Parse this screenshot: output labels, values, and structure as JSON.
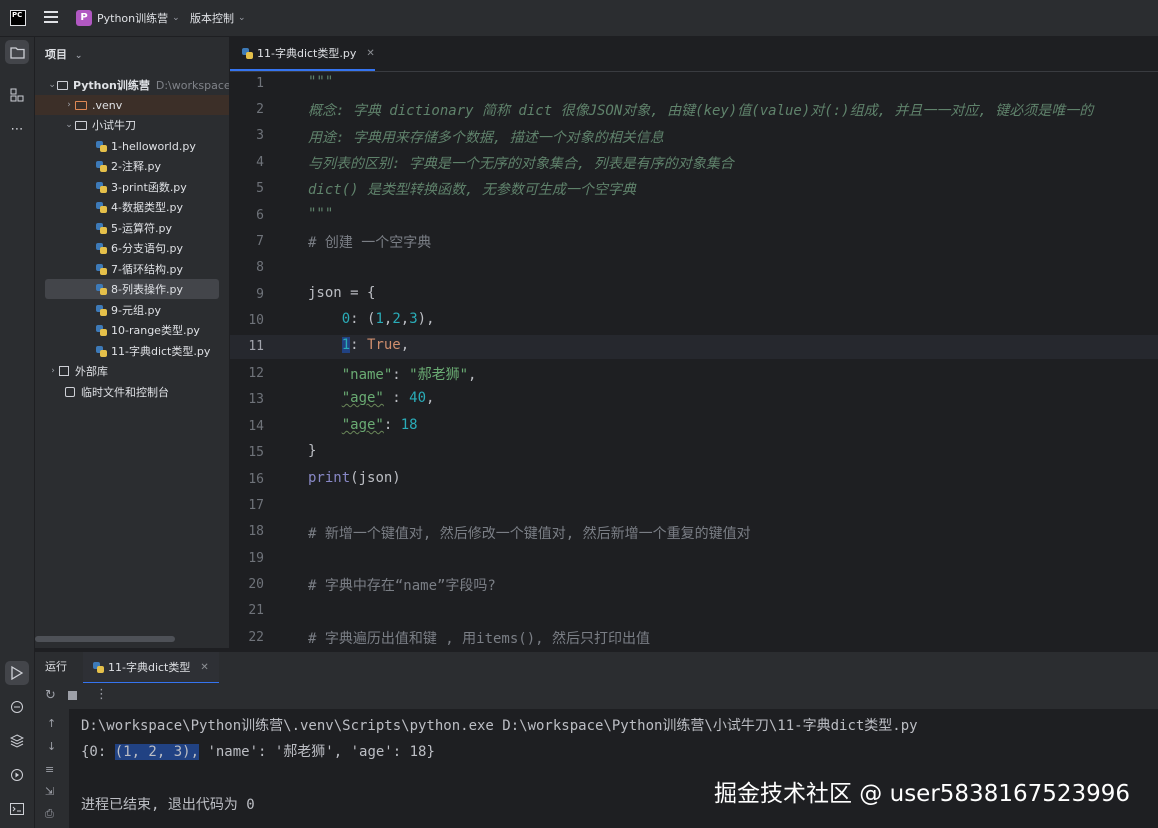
{
  "titlebar": {
    "app_logo": "PC",
    "project_name": "Python训练营",
    "project_badge": "P",
    "vcs_label": "版本控制"
  },
  "project_panel": {
    "header": "项目",
    "tree": [
      {
        "label": "Python训练营",
        "path": "D:\\workspace\\P",
        "type": "root",
        "expanded": true
      },
      {
        "label": ".venv",
        "type": "venv-folder",
        "expanded": false
      },
      {
        "label": "小试牛刀",
        "type": "folder",
        "expanded": true
      },
      {
        "label": "1-helloworld.py",
        "type": "py"
      },
      {
        "label": "2-注释.py",
        "type": "py"
      },
      {
        "label": "3-print函数.py",
        "type": "py"
      },
      {
        "label": "4-数据类型.py",
        "type": "py"
      },
      {
        "label": "5-运算符.py",
        "type": "py"
      },
      {
        "label": "6-分支语句.py",
        "type": "py"
      },
      {
        "label": "7-循环结构.py",
        "type": "py"
      },
      {
        "label": "8-列表操作.py",
        "type": "py",
        "selected": true
      },
      {
        "label": "9-元组.py",
        "type": "py"
      },
      {
        "label": "10-range类型.py",
        "type": "py"
      },
      {
        "label": "11-字典dict类型.py",
        "type": "py"
      },
      {
        "label": "外部库",
        "type": "library",
        "expanded": false
      },
      {
        "label": "临时文件和控制台",
        "type": "scratch"
      }
    ]
  },
  "editor": {
    "tab_label": "11-字典dict类型.py",
    "current_line": 11,
    "line_numbers": [
      "1",
      "2",
      "3",
      "4",
      "5",
      "6",
      "7",
      "8",
      "9",
      "10",
      "11",
      "12",
      "13",
      "14",
      "15",
      "16",
      "17",
      "18",
      "19",
      "20",
      "21",
      "22"
    ],
    "lines": {
      "l1": "\"\"\"",
      "l2": "概念: 字典 dictionary 简称 dict 很像JSON对象, 由键(key)值(value)对(:)组成, 并且一一对应, 键必须是唯一的",
      "l3": "用途: 字典用来存储多个数据, 描述一个对象的相关信息",
      "l4": "与列表的区别: 字典是一个无序的对象集合, 列表是有序的对象集合",
      "l5": "dict() 是类型转换函数, 无参数可生成一个空字典",
      "l6": "\"\"\"",
      "l7": "# 创建 一个空字典",
      "l9a": "json",
      "l9b": " = {",
      "l10a": "    ",
      "l10b": "0",
      "l10c": ": (",
      "l10d": "1",
      "l10e": ",",
      "l10f": "2",
      "l10g": ",",
      "l10h": "3",
      "l10i": "),",
      "l11a": "    ",
      "l11b": "1",
      "l11c": ": ",
      "l11d": "True",
      "l11e": ",",
      "l12a": "    ",
      "l12b": "\"name\"",
      "l12c": ": ",
      "l12d": "\"郝老狮\"",
      "l12e": ",",
      "l13a": "    ",
      "l13b": "\"age\"",
      "l13c": " : ",
      "l13d": "40",
      "l13e": ",",
      "l14a": "    ",
      "l14b": "\"age\"",
      "l14c": ": ",
      "l14d": "18",
      "l15": "}",
      "l16a": "print",
      "l16b": "(json)",
      "l18": "# 新增一个键值对, 然后修改一个键值对, 然后新增一个重复的键值对",
      "l20": "# 字典中存在“name”字段吗?",
      "l22": "# 字典遍历出值和键 , 用items(), 然后只打印出值"
    }
  },
  "run_panel": {
    "title": "运行",
    "tab_label": "11-字典dict类型",
    "console": {
      "command": "D:\\workspace\\Python训练营\\.venv\\Scripts\\python.exe D:\\workspace\\Python训练营\\小试牛刀\\11-字典dict类型.py",
      "output_prefix": "{0: ",
      "output_selected": "(1, 2, 3),",
      "output_suffix": " 'name': '郝老狮', 'age': 18}",
      "exit_message": "进程已结束, 退出代码为 0"
    }
  },
  "watermark": "掘金技术社区 @ user5838167523996",
  "colors": {
    "accent": "#3574f0",
    "selection": "#214283",
    "docstring": "#5f826b",
    "number": "#2aacb8",
    "string": "#6aab73",
    "keyword": "#cf8e6d"
  }
}
